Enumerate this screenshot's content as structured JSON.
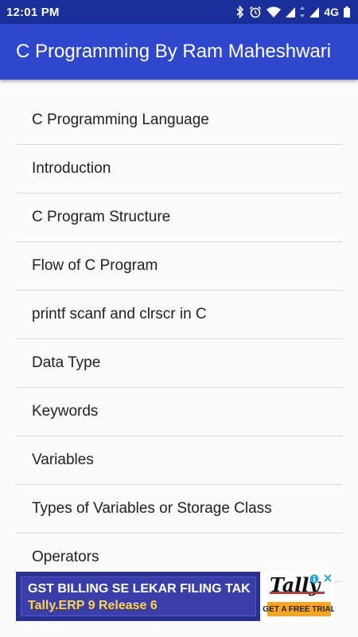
{
  "status_bar": {
    "time": "12:01 PM",
    "network": "4G",
    "icons": [
      "bluetooth-icon",
      "alarm-icon",
      "wifi-icon",
      "signal-icon",
      "data-arrows-icon",
      "signal-icon",
      "battery-icon"
    ]
  },
  "app_bar": {
    "title": "C Programming By Ram Maheshwari"
  },
  "topics": [
    {
      "label": "C Programming Language"
    },
    {
      "label": "Introduction"
    },
    {
      "label": "C Program Structure"
    },
    {
      "label": "Flow of C Program"
    },
    {
      "label": "printf scanf and clrscr in C"
    },
    {
      "label": "Data Type"
    },
    {
      "label": "Keywords"
    },
    {
      "label": "Variables"
    },
    {
      "label": "Types of Variables or Storage Class"
    },
    {
      "label": "Operators"
    }
  ],
  "ad": {
    "headline": "GST BILLING SE LEKAR FILING TAK",
    "subline": "Tally.ERP 9 Release 6",
    "logo": "Tally",
    "cta": "GET A FREE TRIAL"
  },
  "colors": {
    "status_bar": "#1a2f99",
    "app_bar": "#2f47cc",
    "background": "#fafafa",
    "ad_background": "#2b2f8f",
    "ad_subline": "#ffd54a",
    "ad_cta": "#f5a623"
  }
}
